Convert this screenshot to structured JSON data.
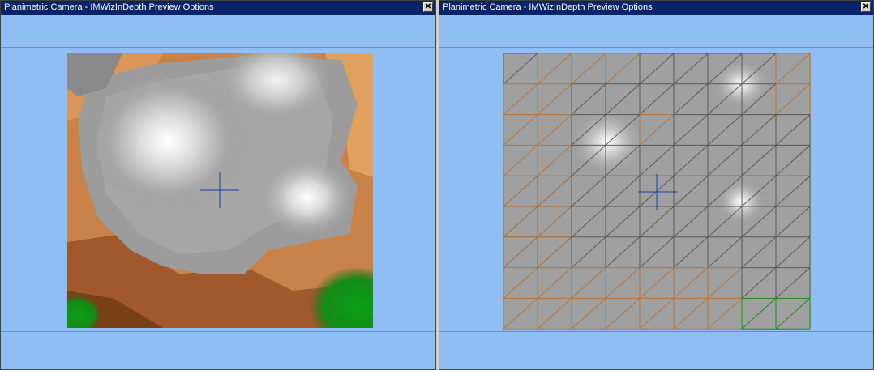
{
  "windows": [
    {
      "id": "left",
      "title": "Planimetric Camera - IMWizInDepth Preview Options",
      "close_glyph": "✕",
      "render_mode": "shaded"
    },
    {
      "id": "right",
      "title": "Planimetric Camera - IMWizInDepth Preview Options",
      "close_glyph": "✕",
      "render_mode": "wireframe"
    }
  ],
  "colors": {
    "background": "#8fbef4",
    "titlebar": "#0a246a",
    "crosshair": "#1a3fa8",
    "terrain_gray": "#9a9a9a",
    "terrain_highlight": "#ffffff",
    "terrain_brown": "#b06a3a",
    "terrain_orange": "#e09a5a",
    "terrain_green": "#0a9a14"
  },
  "icons": {
    "close": "close-icon",
    "crosshair": "crosshair-icon"
  }
}
